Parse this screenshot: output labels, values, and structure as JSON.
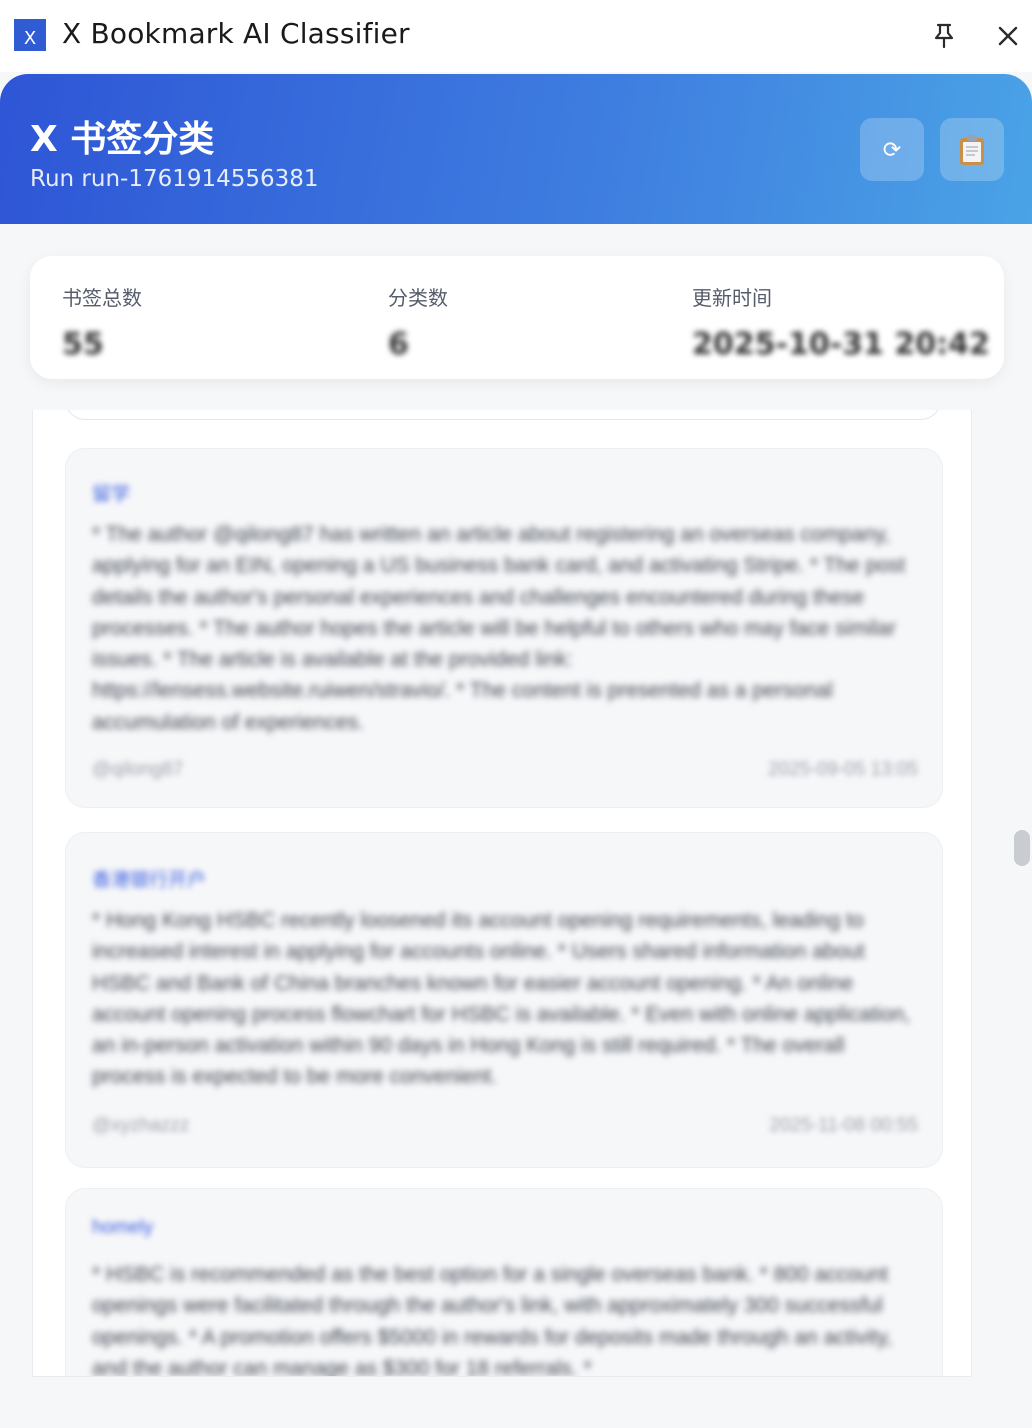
{
  "window": {
    "icon_label": "X",
    "title": "X Bookmark AI Classifier"
  },
  "header": {
    "title": "X 书签分类",
    "subtitle": "Run run-1761914556381",
    "refresh_icon": "⟳",
    "clipboard_icon": "📋"
  },
  "stats": {
    "total_label": "书签总数",
    "total_value": "55",
    "categories_label": "分类数",
    "categories_value": "6",
    "updated_label": "更新时间",
    "updated_value": "2025-10-31 20:42"
  },
  "cards": [
    {
      "category": "留学",
      "text": "* The author @qilong87 has written an article about registering an overseas company, applying for an EIN, opening a US business bank card, and activating Stripe. * The post details the author's personal experiences and challenges encountered during these processes. * The author hopes the article will be helpful to others who may face similar issues. * The article is available at the provided link: https://lensess.website.ruiwen/stravio/. * The content is presented as a personal accumulation of experiences.",
      "author": "@qilong87",
      "date": "2025-09-05 13:05"
    },
    {
      "category": "香港银行开户",
      "text": "* Hong Kong HSBC recently loosened its account opening requirements, leading to increased interest in applying for accounts online. * Users shared information about HSBC and Bank of China branches known for easier account opening. * An online account opening process flowchart for HSBC is available. * Even with online application, an in-person activation within 90 days in Hong Kong is still required. * The overall process is expected to be more convenient.",
      "author": "@xyzhazzz",
      "date": "2025-11-08 00:55"
    },
    {
      "category": "homely",
      "text": "* HSBC is recommended as the best option for a single overseas bank. * 800 account openings were facilitated through the author's link, with approximately 300 successful openings. * A promotion offers $5000 in rewards for deposits made through an activity, and the author can manage as $300 for 18 referrals. *",
      "author": "",
      "date": ""
    }
  ]
}
